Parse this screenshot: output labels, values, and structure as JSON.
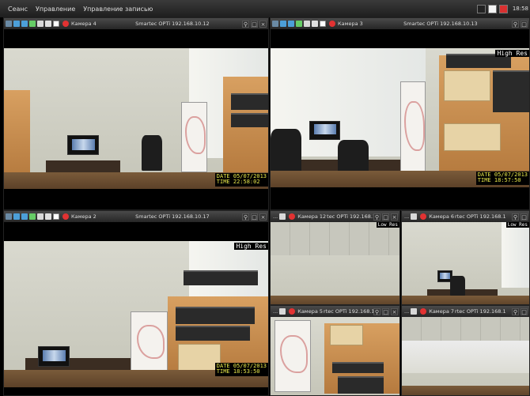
{
  "menu": {
    "items": [
      "Сеанс",
      "Управление",
      "Управление записью"
    ],
    "clock": "18:58"
  },
  "panes": [
    {
      "camera": "Камера 4",
      "source": "Smartec OPTi 192.168.10.12",
      "overlay_top": "",
      "stamp_date": "DATE 05/07/2013",
      "stamp_time": "TIME 22:58:02"
    },
    {
      "camera": "Камера 3",
      "source": "Smartec OPTi 192.168.10.13",
      "overlay_top": "High Res",
      "stamp_date": "DATE 05/07/2013",
      "stamp_time": "TIME 18:57:50"
    },
    {
      "camera": "Камера 2",
      "source": "Smartec OPTi 192.168.10.17",
      "overlay_top": "High Res",
      "stamp_date": "DATE 05/07/2013",
      "stamp_time": "TIME 18:53:50"
    },
    {
      "camera": "Камера 12",
      "source": "tec OPTi 192.168.1",
      "overlay_top": "Low Res",
      "stamp_date": "",
      "stamp_time": ""
    },
    {
      "camera": "Камера 6",
      "source": "rtec OPTi 192.168.1",
      "overlay_top": "Low Res",
      "stamp_date": "",
      "stamp_time": ""
    },
    {
      "camera": "Камера 5",
      "source": "rtec OPTi 192.168.1",
      "overlay_top": "",
      "stamp_date": "",
      "stamp_time": ""
    },
    {
      "camera": "Камера 7",
      "source": "rtec OPTi 192.168.1",
      "overlay_top": "",
      "stamp_date": "",
      "stamp_time": ""
    }
  ],
  "labels": {
    "dots": "...",
    "restore": "□",
    "close": "×",
    "zoom": "⚲"
  },
  "colors": {
    "record": "#e23232",
    "stamp": "#e6e64a",
    "menubar": "#2a2a2a"
  },
  "icons": [
    "settings-icon",
    "layout-icon",
    "globe-icon",
    "ptz-icon",
    "arrows-icon",
    "download-icon",
    "snapshot-icon",
    "record-icon",
    "zoom-icon",
    "restore-icon",
    "close-icon"
  ]
}
